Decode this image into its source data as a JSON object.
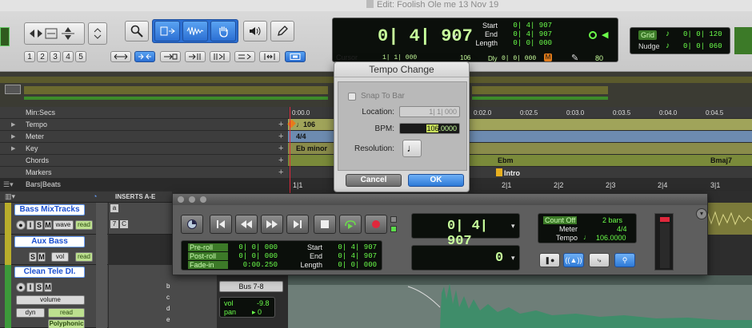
{
  "window": {
    "title": "Edit: Foolish Ole me 13 Nov 19"
  },
  "toolbar": {
    "numbers": [
      "1",
      "2",
      "3",
      "4",
      "5"
    ]
  },
  "counter": {
    "main_value": "0| 4| 907",
    "start_label": "Start",
    "start_value": "0| 4| 907",
    "end_label": "End",
    "end_value": "0| 4| 907",
    "length_label": "Length",
    "length_value": "0| 0| 000",
    "cursor_label": "Cursor",
    "cursor_value": "1| 1| 000",
    "cursor_tempo": "106",
    "dly_label": "Dly",
    "dly_value": "0| 0| 000",
    "volume_value": "80"
  },
  "grid": {
    "grid_label": "Grid",
    "grid_value": "0| 0| 120",
    "nudge_label": "Nudge",
    "nudge_value": "0| 0| 060"
  },
  "ruler": {
    "minsecs_label": "Min:Secs",
    "time_ticks": [
      "0:00.0",
      "0:02.0",
      "0:02.5",
      "0:03.0",
      "0:03.5",
      "0:04.0",
      "0:04.5"
    ],
    "rows": [
      {
        "name": "Tempo",
        "value": "106"
      },
      {
        "name": "Meter",
        "value": "4/4"
      },
      {
        "name": "Key",
        "value": "Eb minor"
      },
      {
        "name": "Chords",
        "values": [
          "Ebm",
          "Bmaj7"
        ]
      },
      {
        "name": "Markers",
        "value": "Intro"
      }
    ],
    "bars_label": "Bars|Beats",
    "bar_ticks": [
      "1|1",
      "2|1",
      "2|2",
      "2|3",
      "2|4",
      "3|1"
    ]
  },
  "inserts_label": "INSERTS A-E",
  "tracks": [
    {
      "name": "Bass MixTracks",
      "buttons": [
        "I",
        "S",
        "M"
      ],
      "mode": "wave",
      "auto": "read",
      "insert_vals": [
        "7",
        "C"
      ]
    },
    {
      "name": "Aux Bass",
      "buttons": [
        "S",
        "M"
      ],
      "mode": "vol",
      "auto": "read"
    },
    {
      "name": "Clean Tele DI.",
      "buttons": [
        "I",
        "S",
        "M"
      ],
      "mode": "volume",
      "plug": "dyn",
      "auto": "read",
      "extra": "Polyphonic",
      "insert_vals": [
        "b",
        "c",
        "d",
        "e"
      ]
    }
  ],
  "io": {
    "bus": "Bus 7-8",
    "vol_label": "vol",
    "vol_value": "-9.8",
    "pan_label": "pan",
    "pan_value": "0"
  },
  "tempo_dialog": {
    "title": "Tempo Change",
    "snap_label": "Snap To Bar",
    "location_label": "Location:",
    "location_value": "1| 1| 000",
    "bpm_label": "BPM:",
    "bpm_value_hl": "106",
    "bpm_value_rest": ".0000",
    "resolution_label": "Resolution:",
    "cancel": "Cancel",
    "ok": "OK"
  },
  "transport": {
    "main_counter": "0| 4| 907",
    "sub_counter": "0",
    "preroll_label": "Pre-roll",
    "preroll_value": "0| 0| 000",
    "postroll_label": "Post-roll",
    "postroll_value": "0| 0| 000",
    "fadein_label": "Fade-in",
    "fadein_value": "0:00.250",
    "start_label": "Start",
    "start_value": "0| 4| 907",
    "end_label": "End",
    "end_value": "0| 4| 907",
    "length_label": "Length",
    "length_value": "0| 0| 000",
    "countoff_label": "Count Off",
    "countoff_value": "2 bars",
    "meter_label": "Meter",
    "meter_value": "4/4",
    "tempo_label": "Tempo",
    "tempo_value": "106.0000"
  },
  "colors": {
    "accent_blue": "#2b6fd3",
    "lcd_green": "#6bff4a",
    "track_yellow": "#b9ad2b",
    "waveform": "#3f8d6a"
  }
}
